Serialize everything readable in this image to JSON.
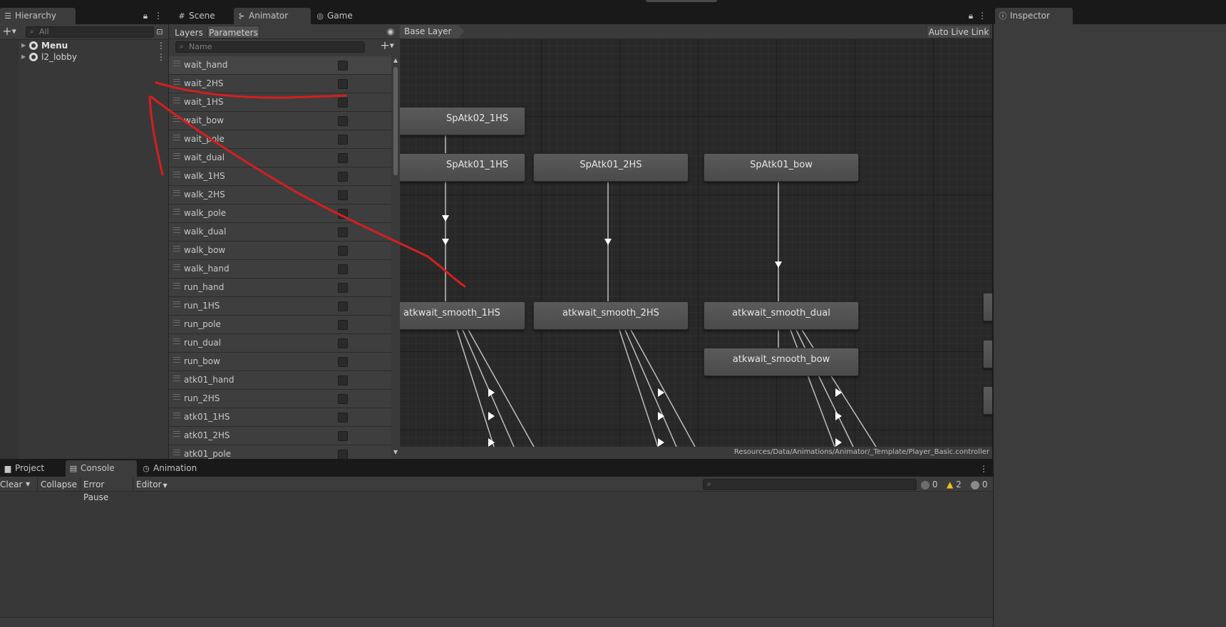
{
  "hierarchy": {
    "tab_label": "Hierarchy",
    "search_placeholder": "All",
    "items": [
      {
        "label": "Menu",
        "bold": true
      },
      {
        "label": "l2_lobby",
        "bold": false
      }
    ]
  },
  "center_tabs": [
    {
      "label": "Scene",
      "icon": "grid-icon",
      "active": false
    },
    {
      "label": "Animator",
      "icon": "animator-icon",
      "active": true
    },
    {
      "label": "Game",
      "icon": "gamepad-icon",
      "active": false
    }
  ],
  "inspector": {
    "tab_label": "Inspector"
  },
  "animator": {
    "subtabs": [
      "Layers",
      "Parameters"
    ],
    "active_subtab": "Parameters",
    "param_search_placeholder": "Name",
    "parameters": [
      "wait_hand",
      "wait_2HS",
      "wait_1HS",
      "wait_bow",
      "wait_pole",
      "wait_dual",
      "walk_1HS",
      "walk_2HS",
      "walk_pole",
      "walk_dual",
      "walk_bow",
      "walk_hand",
      "run_hand",
      "run_1HS",
      "run_pole",
      "run_dual",
      "run_bow",
      "atk01_hand",
      "run_2HS",
      "atk01_1HS",
      "atk01_2HS",
      "atk01_pole"
    ],
    "breadcrumb": "Base Layer",
    "auto_live_link": "Auto Live Link",
    "footer_path": "Resources/Data/Animations/Animator/_Template/Player_Basic.controller",
    "states": [
      "SpAtk02_1HS",
      "SpAtk01_1HS",
      "SpAtk01_2HS",
      "SpAtk01_bow",
      "atkwait_smooth_1HS",
      "atkwait_smooth_2HS",
      "atkwait_smooth_dual",
      "atkwait_smooth_bow"
    ]
  },
  "bottom": {
    "tabs": [
      "Project",
      "Console",
      "Animation"
    ],
    "active_tab": "Console",
    "toolbar": {
      "clear": "Clear",
      "collapse": "Collapse",
      "error_pause": "Error Pause",
      "editor": "Editor"
    },
    "counts": {
      "info": "0",
      "warning": "2",
      "error": "0"
    }
  },
  "colors": {
    "annotation": "#d41f1f",
    "warning": "#f0c020"
  }
}
